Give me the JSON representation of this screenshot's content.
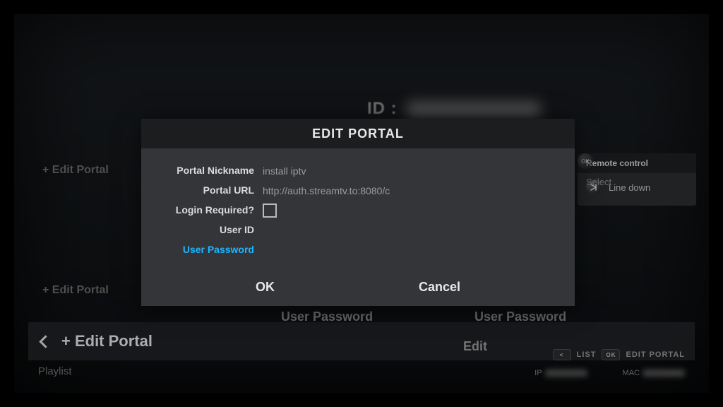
{
  "background": {
    "id_prefix": "ID :",
    "sidebar": {
      "item1": "+ Edit Portal",
      "item2": "+ Edit Portal",
      "selected": "+ Edit Portal"
    },
    "user_password_a": "User Password",
    "user_password_b": "User Password",
    "edit_label": "Edit",
    "playlist_label": "Playlist",
    "hints": {
      "list_key": "<",
      "list_label": "LIST",
      "ok_key": "OK",
      "ok_label": "EDIT PORTAL"
    },
    "ip_label": "IP",
    "mac_label": "MAC"
  },
  "modal": {
    "title": "EDIT PORTAL",
    "fields": {
      "nickname_label": "Portal Nickname",
      "nickname_value": "install iptv",
      "url_label": "Portal URL",
      "url_value": "http://auth.streamtv.to:8080/c",
      "login_label": "Login Required?",
      "login_checked": false,
      "userid_label": "User ID",
      "userid_value": "",
      "password_label": "User Password",
      "password_value": ""
    },
    "buttons": {
      "ok": "OK",
      "cancel": "Cancel"
    }
  },
  "remote": {
    "title": "Remote control",
    "line_down": "Line down",
    "select": "Select",
    "select_key": "OK"
  }
}
